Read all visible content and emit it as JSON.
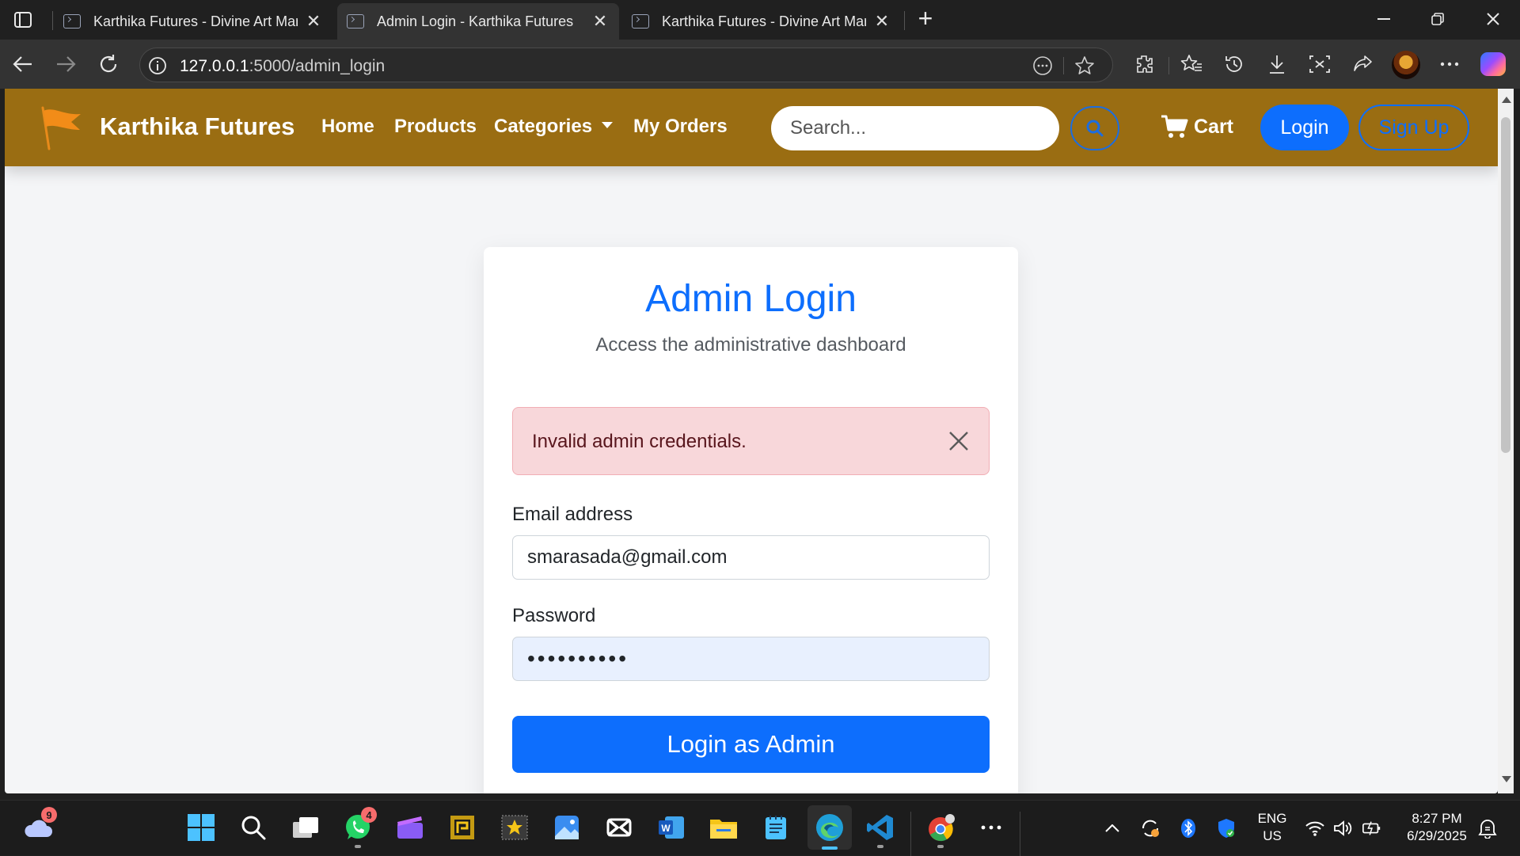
{
  "browser": {
    "tabs": [
      {
        "title": "Karthika Futures - Divine Art Market",
        "close": "✕",
        "active": false
      },
      {
        "title": "Admin Login - Karthika Futures",
        "close": "✕",
        "active": true
      },
      {
        "title": "Karthika Futures - Divine Art Market",
        "close": "✕",
        "active": false
      }
    ],
    "new_tab": "+",
    "url_host": "127.0.0.1",
    "url_path": ":5000/admin_login"
  },
  "site": {
    "brand": "Karthika Futures",
    "nav": {
      "home": "Home",
      "products": "Products",
      "categories": "Categories",
      "my_orders": "My Orders"
    },
    "search_placeholder": "Search...",
    "cart": "Cart",
    "login": "Login",
    "signup": "Sign Up",
    "accent": "#0d6efd",
    "navbar_color": "#9a6d12"
  },
  "login_card": {
    "title": "Admin Login",
    "subtitle": "Access the administrative dashboard",
    "alert": "Invalid admin credentials.",
    "email_label": "Email address",
    "email_value": "smarasada@gmail.com",
    "password_label": "Password",
    "password_value": "••••••••••",
    "submit": "Login as Admin"
  },
  "taskbar": {
    "weather_badge": "9",
    "whatsapp_badge": "4",
    "language": "ENG",
    "region": "US",
    "time": "8:27 PM",
    "date": "6/29/2025"
  }
}
